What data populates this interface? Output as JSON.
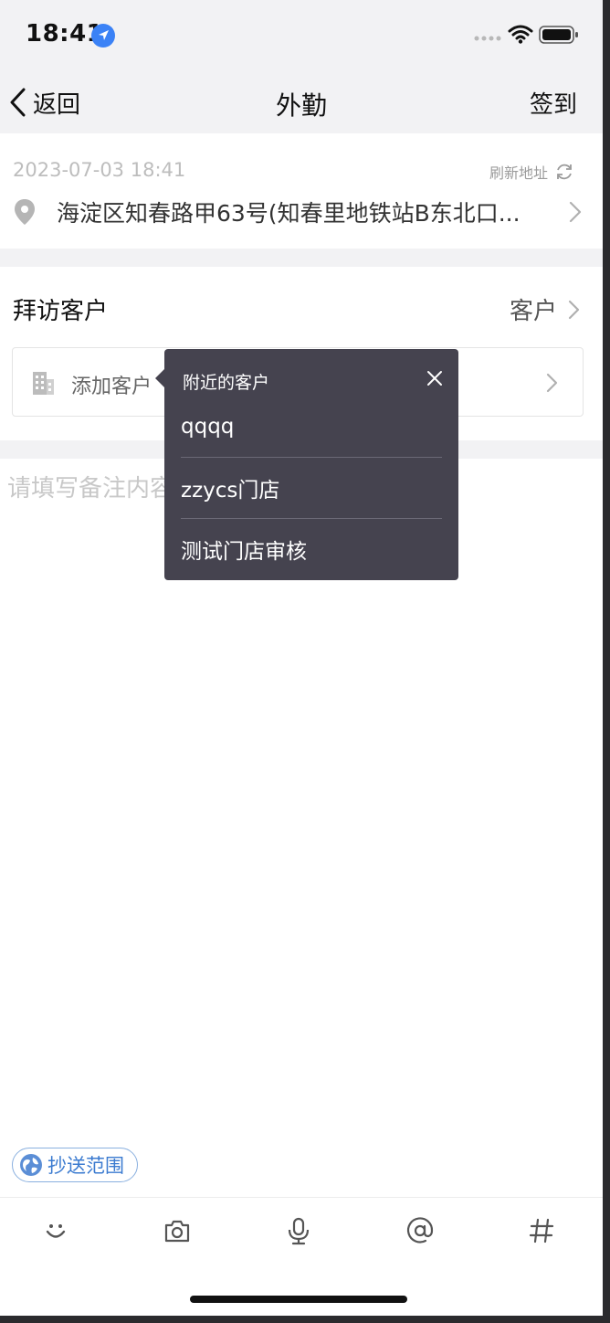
{
  "status_bar": {
    "time": "18:41"
  },
  "nav": {
    "back_label": "返回",
    "title": "外勤",
    "action_label": "签到"
  },
  "location": {
    "datetime": "2023-07-03 18:41",
    "refresh_label": "刷新地址",
    "address": "海淀区知春路甲63号(知春里地铁站B东北口..."
  },
  "visit": {
    "title": "拜访客户",
    "right_label": "客户",
    "add_label": "添加客户"
  },
  "remark": {
    "placeholder": "请填写备注内容"
  },
  "popup": {
    "title": "附近的客户",
    "items": [
      {
        "label": "qqqq"
      },
      {
        "label": "zzycs门店"
      },
      {
        "label": "测试门店审核"
      }
    ]
  },
  "cc": {
    "label": "抄送范围"
  },
  "toolbar": {
    "icons": [
      "emoji-icon",
      "camera-icon",
      "microphone-icon",
      "at-icon",
      "hashtag-icon"
    ]
  },
  "colors": {
    "popup_bg": "#45434f",
    "accent_blue": "#3b7bd0",
    "location_blue": "#3b82f6",
    "page_bg": "#ffffff",
    "bar_bg": "#f2f2f4"
  }
}
